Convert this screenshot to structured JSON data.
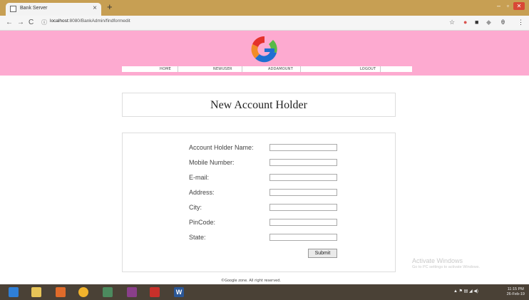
{
  "browser": {
    "tab_title": "Bank Server",
    "tab_close": "×",
    "new_tab": "+",
    "url_host": "localhost",
    "url_rest": ":8080/BankAdmin/findformedit",
    "back": "←",
    "forward": "→",
    "reload": "C",
    "info_icon": "ⓘ",
    "star": "☆",
    "menu": "⋮",
    "profile": "θ"
  },
  "header": {
    "colors": {
      "band": "#fdaad0",
      "logo_orange": "#f28c28",
      "logo_blue": "#1f6fd1",
      "logo_green": "#5ab947",
      "logo_red": "#e4322b"
    },
    "nav": [
      {
        "label": "HOME"
      },
      {
        "label": "NEWUSER"
      },
      {
        "label": "ADDAMOUNT"
      },
      {
        "label": "LOGOUT"
      }
    ]
  },
  "page": {
    "heading": "New Account Holder",
    "form": {
      "fields": [
        {
          "label": "Account Holder Name:",
          "value": ""
        },
        {
          "label": "Mobile Number:",
          "value": ""
        },
        {
          "label": "E-mail:",
          "value": ""
        },
        {
          "label": "Address:",
          "value": ""
        },
        {
          "label": "City:",
          "value": ""
        },
        {
          "label": "PinCode:",
          "value": ""
        },
        {
          "label": "State:",
          "value": ""
        }
      ],
      "submit_label": "Submit"
    },
    "footer": "©Google zone. All right reserved."
  },
  "watermark": {
    "line1": "Activate Windows",
    "line2": "Go to PC settings to activate Windows."
  },
  "taskbar": {
    "time": "11:15 PM",
    "date": "26-Feb-19"
  }
}
